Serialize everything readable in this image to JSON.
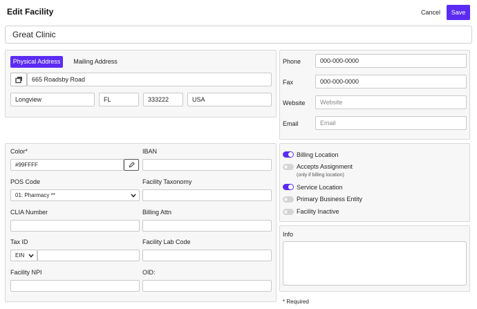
{
  "header": {
    "title": "Edit Facility",
    "cancel_label": "Cancel",
    "save_label": "Save"
  },
  "facility_name": "Great Clinic",
  "address": {
    "tabs": [
      "Physical Address",
      "Mailing Address"
    ],
    "street": "665 Roadsby Road",
    "city": "Longview",
    "state": "FL",
    "zip": "333222",
    "country": "USA"
  },
  "contact": {
    "phone_label": "Phone",
    "phone_value": "000-000-0000",
    "fax_label": "Fax",
    "fax_value": "000-000-0000",
    "website_label": "Website",
    "website_placeholder": "Website",
    "email_label": "Email",
    "email_placeholder": "Email"
  },
  "details": {
    "color_label": "Color*",
    "color_value": "#99FFFF",
    "iban_label": "IBAN",
    "pos_code_label": "POS Code",
    "pos_code_value": "01: Pharmacy **",
    "facility_taxonomy_label": "Facility Taxonomy",
    "clia_label": "CLIA Number",
    "billing_attn_label": "Billing Attn",
    "tax_id_label": "Tax ID",
    "tax_id_type": "EIN",
    "facility_lab_code_label": "Facility Lab Code",
    "facility_npi_label": "Facility NPI",
    "oid_label": "OID:"
  },
  "toggles": [
    {
      "label": "Billing Location",
      "on": true
    },
    {
      "label": "Accepts Assignment",
      "on": false,
      "sublabel": "(only if billing location)"
    },
    {
      "label": "Service Location",
      "on": true
    },
    {
      "label": "Primary Business Entity",
      "on": false
    },
    {
      "label": "Facility Inactive",
      "on": false
    }
  ],
  "info_label": "Info",
  "required_note": "* Required",
  "colors": {
    "accent": "#5b2bf3",
    "panel_bg": "#f7f7f8",
    "border": "#d8d8d8"
  }
}
